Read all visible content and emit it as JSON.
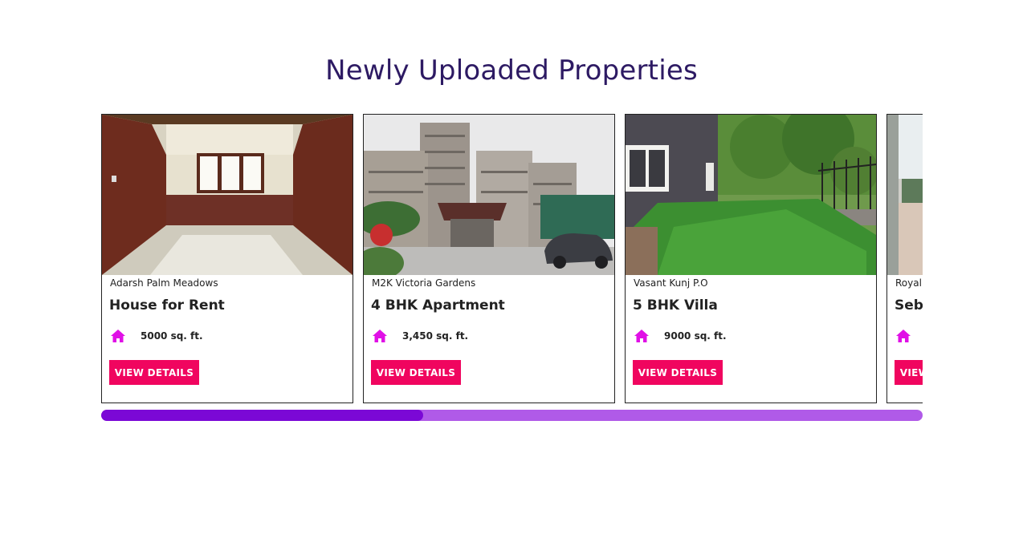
{
  "section": {
    "title": "Newly Uploaded Properties"
  },
  "icons": {
    "area": "home-icon"
  },
  "colors": {
    "title": "#2d1a63",
    "button": "#f0055f",
    "icon": "#e010e6",
    "scroll_track": "#b05ae8",
    "scroll_thumb": "#7b08d6"
  },
  "properties": [
    {
      "location": "Adarsh Palm Meadows",
      "title": "House for Rent",
      "area": "5000 sq. ft.",
      "button": "VIEW DETAILS"
    },
    {
      "location": "M2K Victoria Gardens",
      "title": "4 BHK Apartment",
      "area": "3,450 sq. ft.",
      "button": "VIEW DETAILS"
    },
    {
      "location": "Vasant Kunj P.O",
      "title": "5 BHK Villa",
      "area": "9000 sq. ft.",
      "button": "VIEW DETAILS"
    },
    {
      "location": "Royal",
      "title": "Seb",
      "area": "",
      "button": "VIEW DETAILS"
    }
  ],
  "scroll": {
    "position_fraction": 0.39
  }
}
